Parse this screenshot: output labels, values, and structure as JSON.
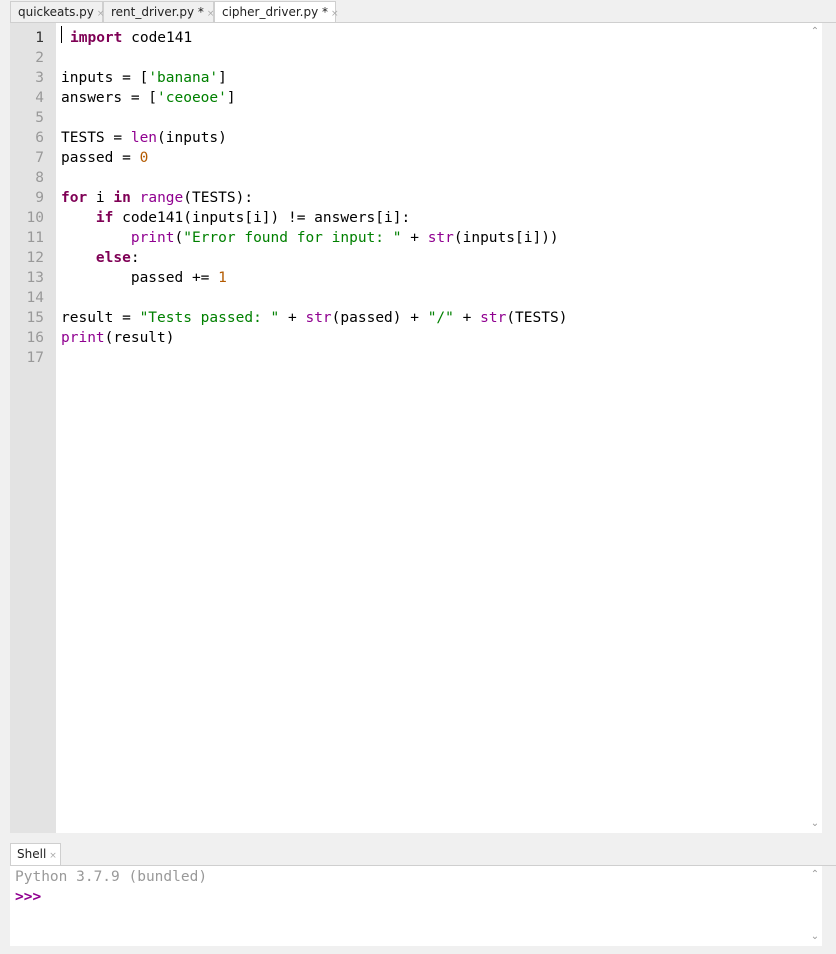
{
  "tabs": [
    {
      "label": "quickeats.py",
      "close": "×"
    },
    {
      "label": "rent_driver.py *",
      "close": "×"
    },
    {
      "label": "cipher_driver.py *",
      "close": "×"
    }
  ],
  "editor": {
    "lines": [
      {
        "n": "1"
      },
      {
        "n": "2"
      },
      {
        "n": "3"
      },
      {
        "n": "4"
      },
      {
        "n": "5"
      },
      {
        "n": "6"
      },
      {
        "n": "7"
      },
      {
        "n": "8"
      },
      {
        "n": "9"
      },
      {
        "n": "10"
      },
      {
        "n": "11"
      },
      {
        "n": "12"
      },
      {
        "n": "13"
      },
      {
        "n": "14"
      },
      {
        "n": "15"
      },
      {
        "n": "16"
      },
      {
        "n": "17"
      }
    ],
    "tokens": {
      "l1": [
        "import",
        " code141"
      ],
      "l3": [
        "inputs = [",
        "'banana'",
        "]"
      ],
      "l4": [
        "answers = [",
        "'ceoeoe'",
        "]"
      ],
      "l6": [
        "TESTS = ",
        "len",
        "(inputs)"
      ],
      "l7": [
        "passed = ",
        "0"
      ],
      "l9": [
        "for",
        " i ",
        "in",
        " ",
        "range",
        "(TESTS):"
      ],
      "l10": [
        "    ",
        "if",
        " code141(inputs[i]) != answers[i]:"
      ],
      "l11": [
        "        ",
        "print",
        "(",
        "\"Error found for input: \"",
        " + ",
        "str",
        "(inputs[i]))"
      ],
      "l12": [
        "    ",
        "else",
        ":"
      ],
      "l13": [
        "        passed += ",
        "1"
      ],
      "l15": [
        "result = ",
        "\"Tests passed: \"",
        " + ",
        "str",
        "(passed) + ",
        "\"/\"",
        " + ",
        "str",
        "(TESTS)"
      ],
      "l16": [
        "print",
        "(result)"
      ]
    }
  },
  "shell": {
    "tab_label": "Shell",
    "close": "×",
    "banner": "Python 3.7.9 (bundled)",
    "prompt": ">>>"
  },
  "icons": {
    "scroll_up": "up-arrow-icon",
    "scroll_down": "down-arrow-icon"
  }
}
